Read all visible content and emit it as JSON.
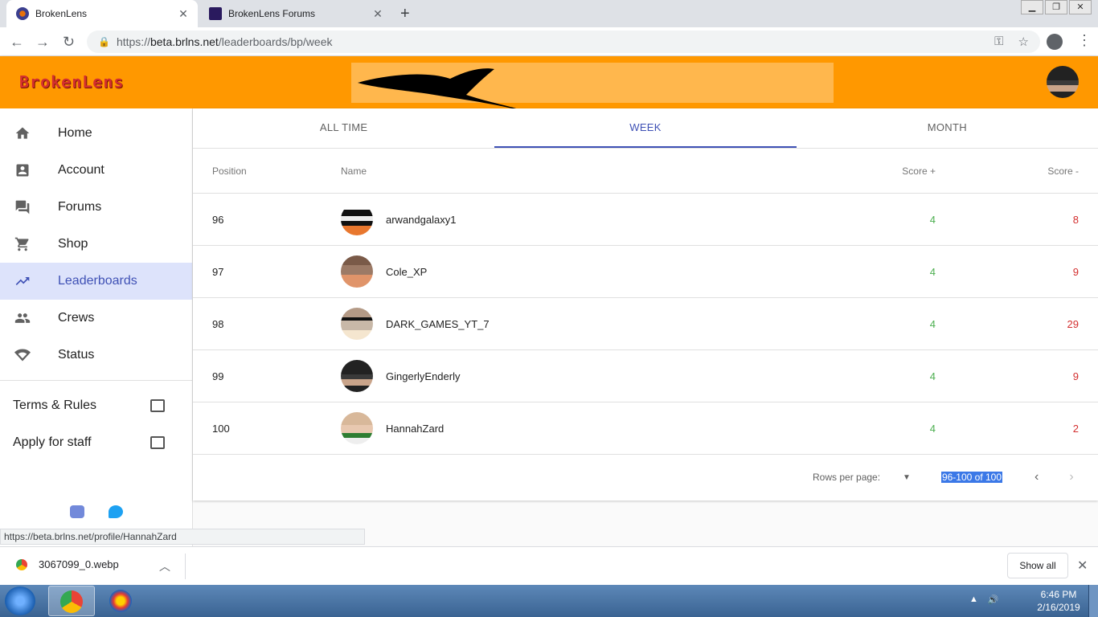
{
  "browser": {
    "tabs": [
      {
        "title": "BrokenLens",
        "active": true
      },
      {
        "title": "BrokenLens Forums",
        "active": false
      }
    ],
    "new_tab": "+",
    "url_prefix": "https://",
    "url_host": "beta.brlns.net",
    "url_path": "/leaderboards/bp/week"
  },
  "app": {
    "brand": "BrokenLens"
  },
  "sidebar": {
    "items": [
      {
        "label": "Home",
        "icon": "home-icon",
        "active": false
      },
      {
        "label": "Account",
        "icon": "account-icon",
        "active": false
      },
      {
        "label": "Forums",
        "icon": "forum-icon",
        "active": false
      },
      {
        "label": "Shop",
        "icon": "cart-icon",
        "active": false
      },
      {
        "label": "Leaderboards",
        "icon": "trending-icon",
        "active": true
      },
      {
        "label": "Crews",
        "icon": "people-icon",
        "active": false
      },
      {
        "label": "Status",
        "icon": "signal-icon",
        "active": false
      }
    ],
    "links": [
      {
        "label": "Terms & Rules"
      },
      {
        "label": "Apply for staff"
      }
    ]
  },
  "leaderboard": {
    "tabs": [
      "ALL TIME",
      "WEEK",
      "MONTH"
    ],
    "active_tab": "WEEK",
    "columns": {
      "position": "Position",
      "name": "Name",
      "score_plus": "Score +",
      "score_minus": "Score -"
    },
    "rows": [
      {
        "position": "96",
        "name": "arwandgalaxy1",
        "score_plus": "4",
        "score_minus": "8"
      },
      {
        "position": "97",
        "name": "Cole_XP",
        "score_plus": "4",
        "score_minus": "9"
      },
      {
        "position": "98",
        "name": "DARK_GAMES_YT_7",
        "score_plus": "4",
        "score_minus": "29"
      },
      {
        "position": "99",
        "name": "GingerlyEnderly",
        "score_plus": "4",
        "score_minus": "9"
      },
      {
        "position": "100",
        "name": "HannahZard",
        "score_plus": "4",
        "score_minus": "2"
      }
    ],
    "pagination": {
      "rows_per_page_label": "Rows per page:",
      "range": "96-100 of 100"
    }
  },
  "status_url": "https://beta.brlns.net/profile/HannahZard",
  "downloads": {
    "file": "3067099_0.webp",
    "show_all": "Show all"
  },
  "taskbar": {
    "time": "6:46 PM",
    "date": "2/16/2019"
  },
  "colors": {
    "appbar": "#ff9800",
    "brand": "#d32f2f",
    "accent": "#3f51b5",
    "score_plus": "#4caf50",
    "score_minus": "#d32f2f"
  }
}
